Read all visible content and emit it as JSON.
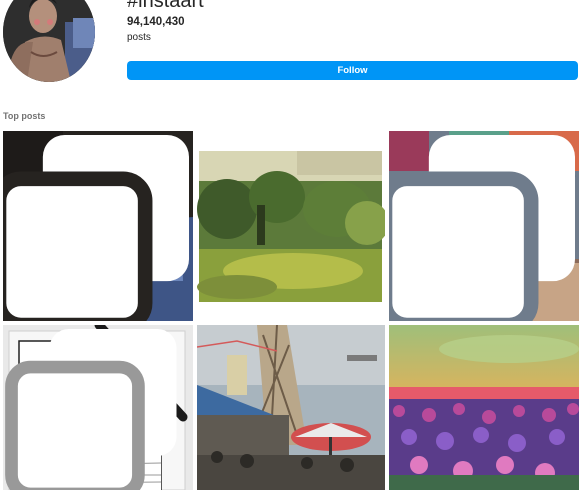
{
  "header": {
    "hashtag": "#instaart",
    "post_count": "94,140,430",
    "posts_label": "posts",
    "follow_label": "Follow"
  },
  "top_posts": {
    "label": "Top posts",
    "items": [
      {
        "icon": "multiple-photos-icon"
      },
      {
        "icon": null
      },
      {
        "icon": "multiple-photos-icon"
      },
      {
        "icon": "multiple-photos-icon"
      },
      {
        "icon": null
      },
      {
        "icon": null
      }
    ]
  },
  "colors": {
    "accent": "#0095f6",
    "text": "#262626",
    "muted": "#737373"
  }
}
